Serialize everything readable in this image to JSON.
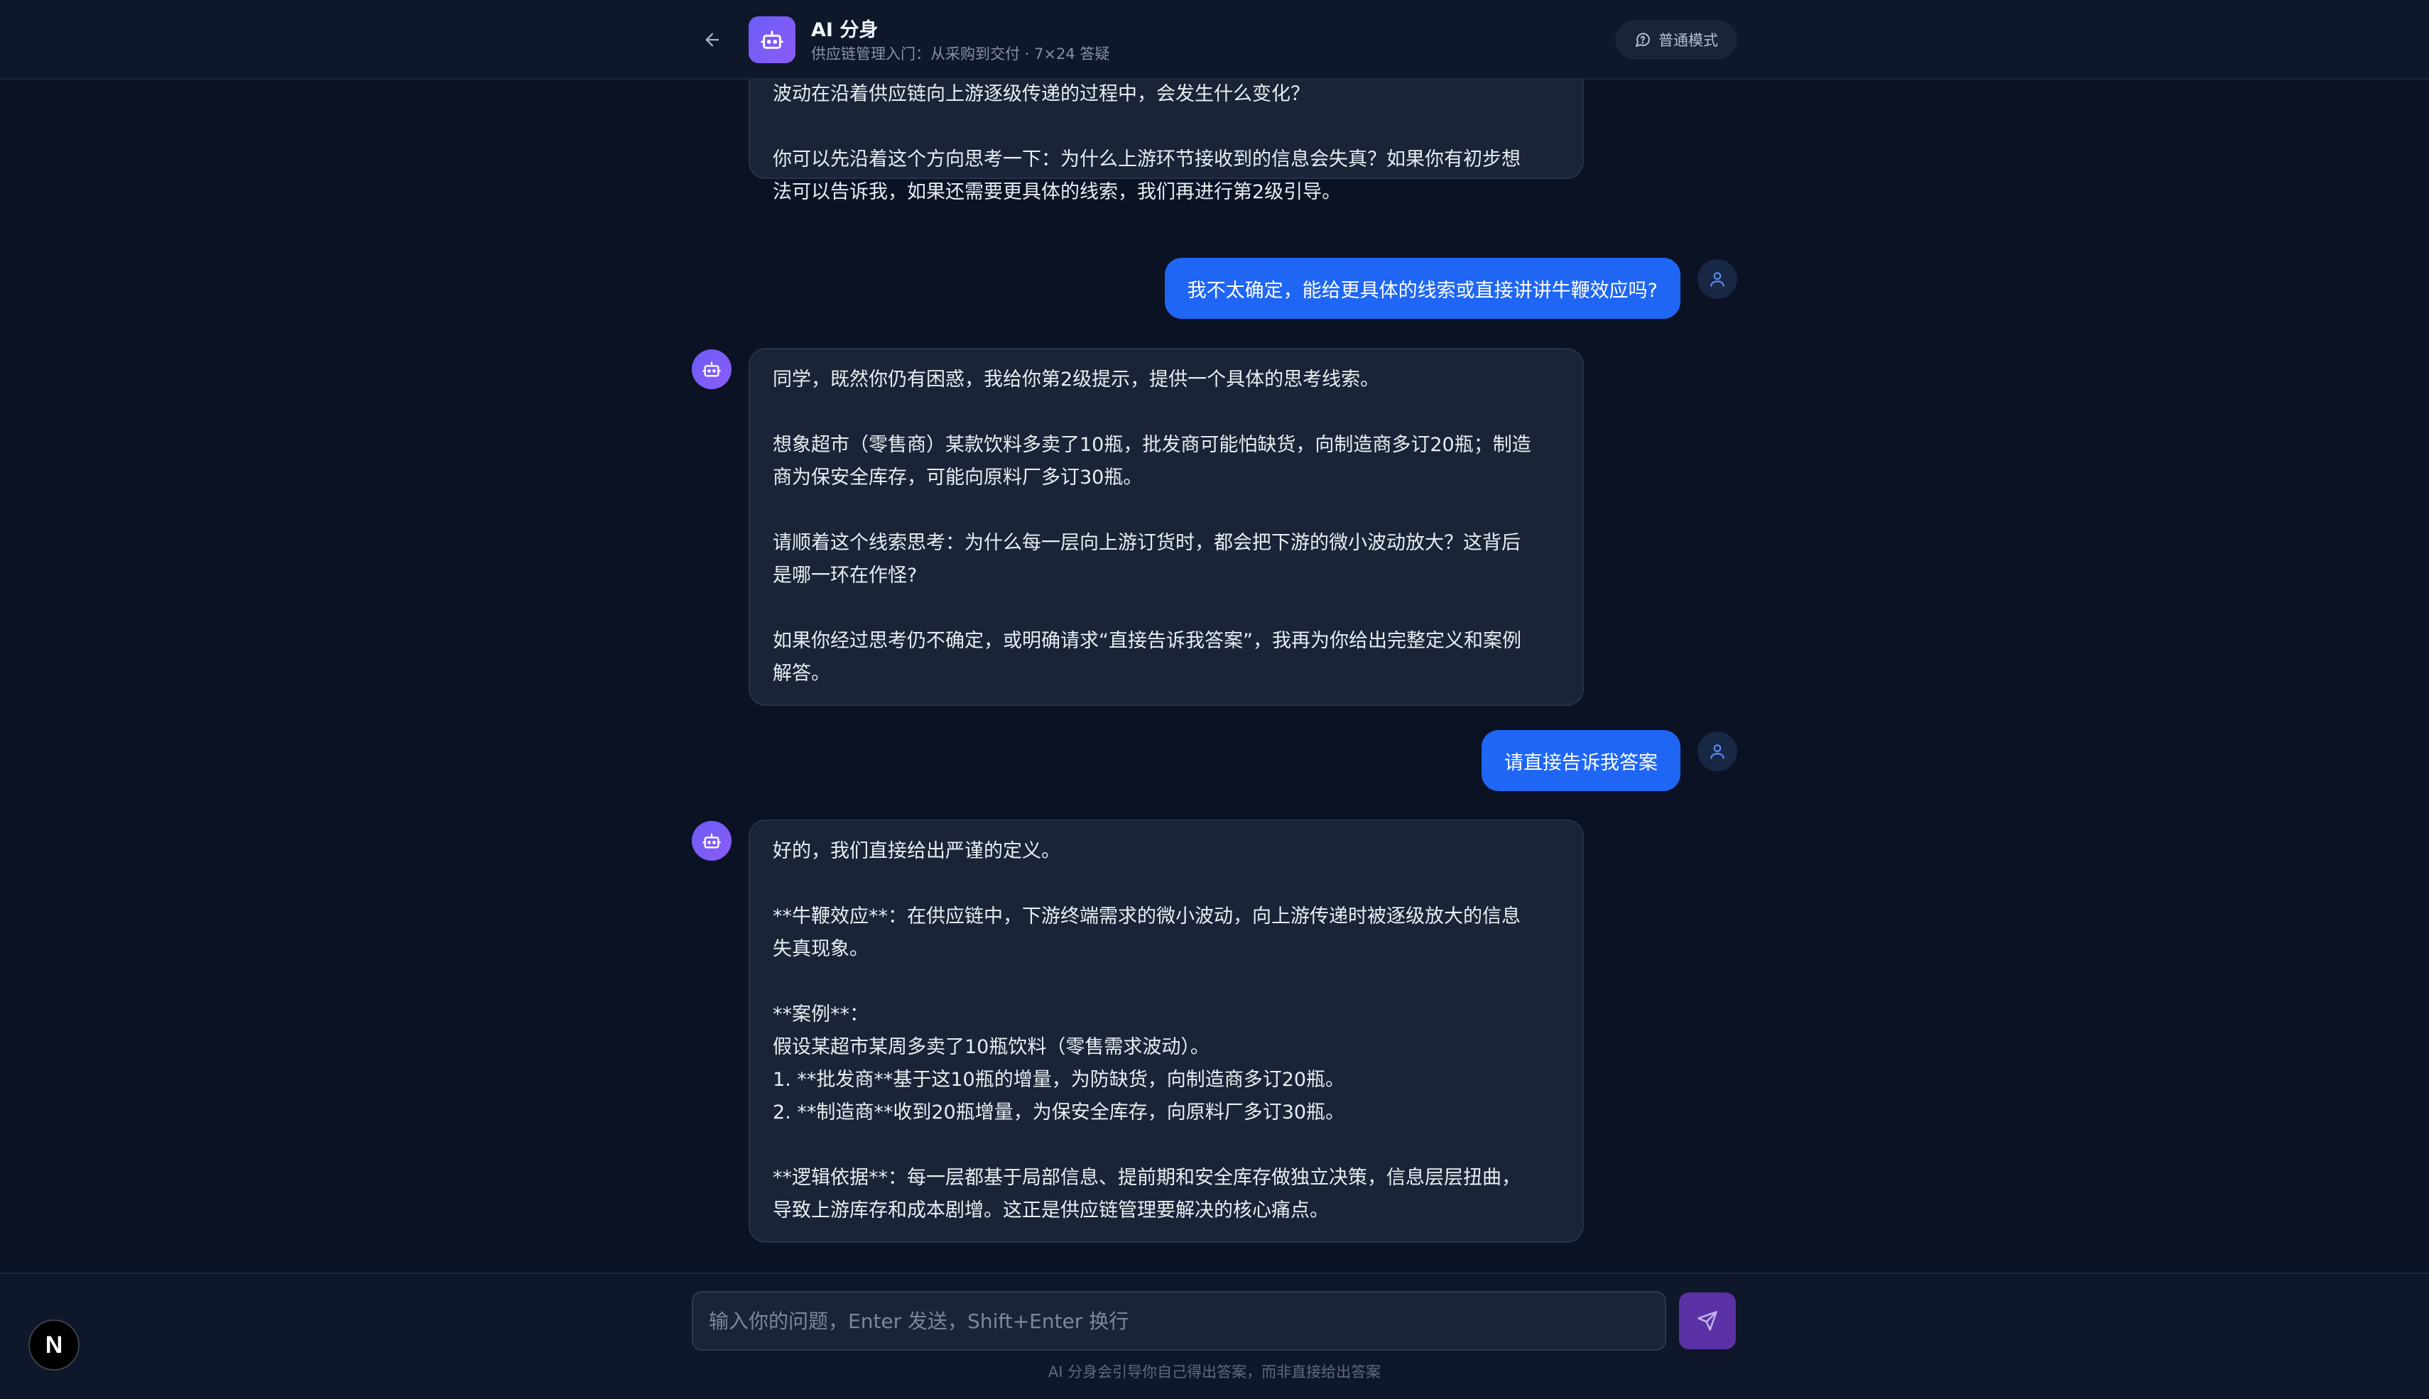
{
  "header": {
    "title": "AI 分身",
    "subtitle": "供应链管理入门：从采购到交付 · 7×24 答疑",
    "mode_label": "普通模式",
    "icons": {
      "back": "arrow-left-icon",
      "app": "robot-icon",
      "mode": "message-circle-icon"
    }
  },
  "messages": [
    {
      "role": "assistant",
      "text": "波动在沿着供应链向上游逐级传递的过程中，会发生什么变化？\n\n你可以先沿着这个方向思考一下：为什么上游环节接收到的信息会失真？如果你有初步想\n法可以告诉我，如果还需要更具体的线索，我们再进行第2级引导。"
    },
    {
      "role": "user",
      "text": "我不太确定，能给更具体的线索或直接讲讲牛鞭效应吗?"
    },
    {
      "role": "assistant",
      "text": "同学，既然你仍有困惑，我给你第2级提示，提供一个具体的思考线索。\n\n想象超市（零售商）某款饮料多卖了10瓶，批发商可能怕缺货，向制造商多订20瓶；制造\n商为保安全库存，可能向原料厂多订30瓶。\n\n请顺着这个线索思考：为什么每一层向上游订货时，都会把下游的微小波动放大？这背后\n是哪一环在作怪?\n\n如果你经过思考仍不确定，或明确请求“直接告诉我答案”，我再为你给出完整定义和案例\n解答。"
    },
    {
      "role": "user",
      "text": "请直接告诉我答案"
    },
    {
      "role": "assistant",
      "text": "好的，我们直接给出严谨的定义。\n\n**牛鞭效应**：在供应链中，下游终端需求的微小波动，向上游传递时被逐级放大的信息\n失真现象。\n\n**案例**：\n假设某超市某周多卖了10瓶饮料（零售需求波动）。\n1. **批发商**基于这10瓶的增量，为防缺货，向制造商多订20瓶。\n2. **制造商**收到20瓶增量，为保安全库存，向原料厂多订30瓶。\n\n**逻辑依据**：每一层都基于局部信息、提前期和安全库存做独立决策，信息层层扭曲，\n导致上游库存和成本剧增。这正是供应链管理要解决的核心痛点。"
    }
  ],
  "footer": {
    "input_placeholder": "输入你的问题，Enter 发送，Shift+Enter 换行",
    "input_value": "",
    "hint": "AI 分身会引导你自己得出答案，而非直接给出答案",
    "send_icon": "send-icon"
  },
  "badge": {
    "letter": "N"
  },
  "colors": {
    "background": "#0b1224",
    "bubble_bot": "#1a2436",
    "bubble_user": "#1f66f4",
    "accent_purple": "#7c5cf6",
    "send_button": "#5b31a6"
  }
}
